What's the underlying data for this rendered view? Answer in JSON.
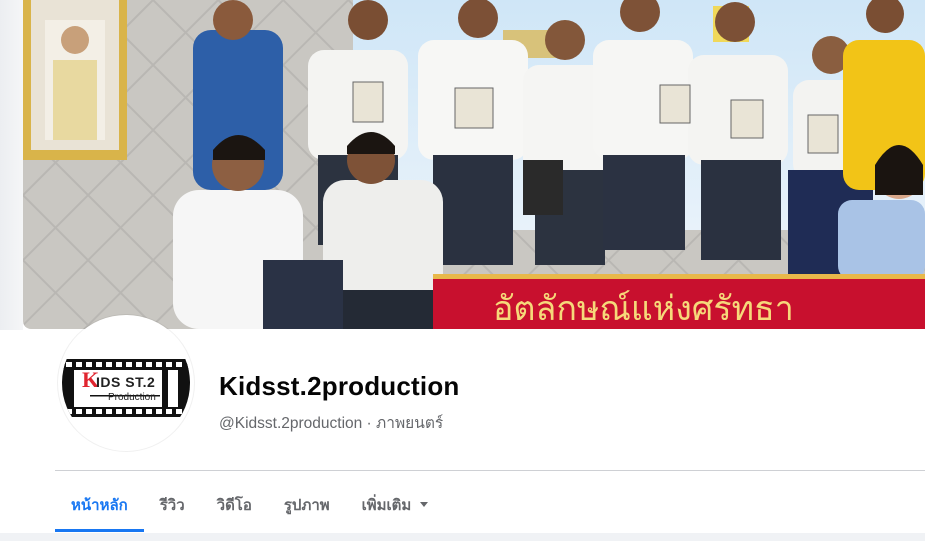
{
  "profile": {
    "name": "Kidsst.2production",
    "meta": "@Kidsst.2production · ภาพยนตร์"
  },
  "cover": {
    "banner_text": "อัตลักษณ์แห่งศรัทธา"
  },
  "logo": {
    "letter_k": "K",
    "main_text": "IDS ST.2",
    "sub_text": "Production"
  },
  "tabs": [
    {
      "label": "หน้าหลัก",
      "active": true
    },
    {
      "label": "รีวิว",
      "active": false
    },
    {
      "label": "วิดีโอ",
      "active": false
    },
    {
      "label": "รูปภาพ",
      "active": false
    },
    {
      "label": "เพิ่มเติม",
      "active": false
    }
  ],
  "colors": {
    "accent": "#1877f2",
    "name_text": "#050505",
    "secondary_text": "#65676b",
    "banner_red": "#c8102e"
  }
}
